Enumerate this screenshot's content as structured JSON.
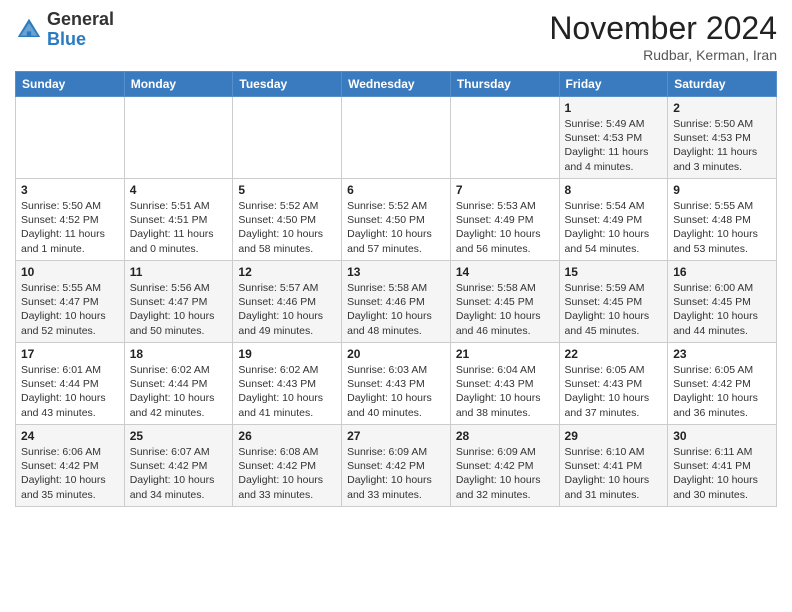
{
  "header": {
    "logo_general": "General",
    "logo_blue": "Blue",
    "month_title": "November 2024",
    "subtitle": "Rudbar, Kerman, Iran"
  },
  "days_of_week": [
    "Sunday",
    "Monday",
    "Tuesday",
    "Wednesday",
    "Thursday",
    "Friday",
    "Saturday"
  ],
  "weeks": [
    [
      {
        "day": "",
        "info": ""
      },
      {
        "day": "",
        "info": ""
      },
      {
        "day": "",
        "info": ""
      },
      {
        "day": "",
        "info": ""
      },
      {
        "day": "",
        "info": ""
      },
      {
        "day": "1",
        "info": "Sunrise: 5:49 AM\nSunset: 4:53 PM\nDaylight: 11 hours\nand 4 minutes."
      },
      {
        "day": "2",
        "info": "Sunrise: 5:50 AM\nSunset: 4:53 PM\nDaylight: 11 hours\nand 3 minutes."
      }
    ],
    [
      {
        "day": "3",
        "info": "Sunrise: 5:50 AM\nSunset: 4:52 PM\nDaylight: 11 hours\nand 1 minute."
      },
      {
        "day": "4",
        "info": "Sunrise: 5:51 AM\nSunset: 4:51 PM\nDaylight: 11 hours\nand 0 minutes."
      },
      {
        "day": "5",
        "info": "Sunrise: 5:52 AM\nSunset: 4:50 PM\nDaylight: 10 hours\nand 58 minutes."
      },
      {
        "day": "6",
        "info": "Sunrise: 5:52 AM\nSunset: 4:50 PM\nDaylight: 10 hours\nand 57 minutes."
      },
      {
        "day": "7",
        "info": "Sunrise: 5:53 AM\nSunset: 4:49 PM\nDaylight: 10 hours\nand 56 minutes."
      },
      {
        "day": "8",
        "info": "Sunrise: 5:54 AM\nSunset: 4:49 PM\nDaylight: 10 hours\nand 54 minutes."
      },
      {
        "day": "9",
        "info": "Sunrise: 5:55 AM\nSunset: 4:48 PM\nDaylight: 10 hours\nand 53 minutes."
      }
    ],
    [
      {
        "day": "10",
        "info": "Sunrise: 5:55 AM\nSunset: 4:47 PM\nDaylight: 10 hours\nand 52 minutes."
      },
      {
        "day": "11",
        "info": "Sunrise: 5:56 AM\nSunset: 4:47 PM\nDaylight: 10 hours\nand 50 minutes."
      },
      {
        "day": "12",
        "info": "Sunrise: 5:57 AM\nSunset: 4:46 PM\nDaylight: 10 hours\nand 49 minutes."
      },
      {
        "day": "13",
        "info": "Sunrise: 5:58 AM\nSunset: 4:46 PM\nDaylight: 10 hours\nand 48 minutes."
      },
      {
        "day": "14",
        "info": "Sunrise: 5:58 AM\nSunset: 4:45 PM\nDaylight: 10 hours\nand 46 minutes."
      },
      {
        "day": "15",
        "info": "Sunrise: 5:59 AM\nSunset: 4:45 PM\nDaylight: 10 hours\nand 45 minutes."
      },
      {
        "day": "16",
        "info": "Sunrise: 6:00 AM\nSunset: 4:45 PM\nDaylight: 10 hours\nand 44 minutes."
      }
    ],
    [
      {
        "day": "17",
        "info": "Sunrise: 6:01 AM\nSunset: 4:44 PM\nDaylight: 10 hours\nand 43 minutes."
      },
      {
        "day": "18",
        "info": "Sunrise: 6:02 AM\nSunset: 4:44 PM\nDaylight: 10 hours\nand 42 minutes."
      },
      {
        "day": "19",
        "info": "Sunrise: 6:02 AM\nSunset: 4:43 PM\nDaylight: 10 hours\nand 41 minutes."
      },
      {
        "day": "20",
        "info": "Sunrise: 6:03 AM\nSunset: 4:43 PM\nDaylight: 10 hours\nand 40 minutes."
      },
      {
        "day": "21",
        "info": "Sunrise: 6:04 AM\nSunset: 4:43 PM\nDaylight: 10 hours\nand 38 minutes."
      },
      {
        "day": "22",
        "info": "Sunrise: 6:05 AM\nSunset: 4:43 PM\nDaylight: 10 hours\nand 37 minutes."
      },
      {
        "day": "23",
        "info": "Sunrise: 6:05 AM\nSunset: 4:42 PM\nDaylight: 10 hours\nand 36 minutes."
      }
    ],
    [
      {
        "day": "24",
        "info": "Sunrise: 6:06 AM\nSunset: 4:42 PM\nDaylight: 10 hours\nand 35 minutes."
      },
      {
        "day": "25",
        "info": "Sunrise: 6:07 AM\nSunset: 4:42 PM\nDaylight: 10 hours\nand 34 minutes."
      },
      {
        "day": "26",
        "info": "Sunrise: 6:08 AM\nSunset: 4:42 PM\nDaylight: 10 hours\nand 33 minutes."
      },
      {
        "day": "27",
        "info": "Sunrise: 6:09 AM\nSunset: 4:42 PM\nDaylight: 10 hours\nand 33 minutes."
      },
      {
        "day": "28",
        "info": "Sunrise: 6:09 AM\nSunset: 4:42 PM\nDaylight: 10 hours\nand 32 minutes."
      },
      {
        "day": "29",
        "info": "Sunrise: 6:10 AM\nSunset: 4:41 PM\nDaylight: 10 hours\nand 31 minutes."
      },
      {
        "day": "30",
        "info": "Sunrise: 6:11 AM\nSunset: 4:41 PM\nDaylight: 10 hours\nand 30 minutes."
      }
    ]
  ]
}
